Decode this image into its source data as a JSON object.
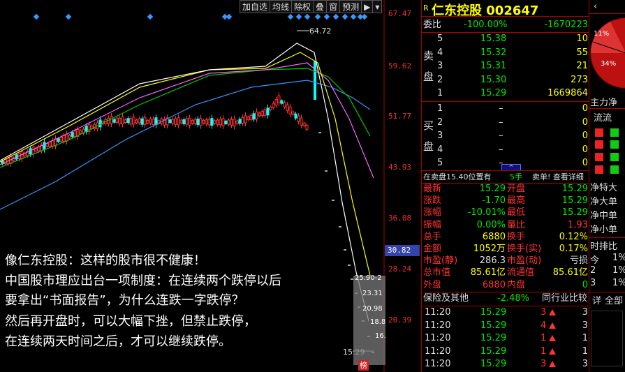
{
  "toolbar": {
    "buttons": [
      "加自选",
      "均线",
      "除权",
      "叠",
      "窗",
      "预测",
      "▶",
      "▾"
    ]
  },
  "chart": {
    "price_axis": [
      "67.47",
      "59.62",
      "51.77",
      "43.93",
      "36.08",
      "28.24",
      "20.39"
    ],
    "current_price_label": "30.82",
    "high_label": "64.72",
    "low_label": "15.29",
    "gray_box_texts": [
      "25.90-2",
      "23.31",
      "20.98",
      "18.8",
      "16."
    ],
    "badge": "榜",
    "overlay_lines": [
      "像仁东控股：这样的股市很不健康！",
      "中国股市理应出台一项制度：在连续两个跌停以后",
      "要拿出“书面报告”，为什么连跌一字跌停？",
      "然后再开盘时，可以大幅下挫，但禁止跌停，",
      "在连续两天时间之后，才可以继续跌停。"
    ],
    "colors": {
      "up": "#ff3333",
      "down": "#00ffff",
      "ma5": "#ffffff",
      "ma10": "#ffff00",
      "ma20": "#ff66ff",
      "ma30": "#00cc00",
      "ma60": "#3399ff"
    }
  },
  "quote": {
    "r_mark": "R",
    "title": "仁东控股 002647",
    "weibi": {
      "label": "委比",
      "pct": "-100.00%",
      "diff": "-1670223"
    },
    "sell_label": "卖盘",
    "buy_label": "买盘",
    "sell": [
      {
        "n": "5",
        "price": "15.38",
        "vol": "10"
      },
      {
        "n": "4",
        "price": "15.32",
        "vol": "55"
      },
      {
        "n": "3",
        "price": "15.31",
        "vol": "21"
      },
      {
        "n": "2",
        "price": "15.30",
        "vol": "273"
      },
      {
        "n": "1",
        "price": "15.29",
        "vol": "1669864"
      }
    ],
    "buy": [
      {
        "n": "1",
        "price": "–",
        "vol": "0"
      },
      {
        "n": "2",
        "price": "–",
        "vol": "0"
      },
      {
        "n": "3",
        "price": "–",
        "vol": "0"
      },
      {
        "n": "4",
        "price": "–",
        "vol": "0"
      },
      {
        "n": "5",
        "price": "–",
        "vol": "0"
      }
    ],
    "big_order": {
      "text": "在卖盘15.40位置有",
      "qty": "5手",
      "suffix": "卖单! 查看详细"
    },
    "stats": [
      {
        "l1": "最新",
        "v1": "15.29",
        "l2": "开盘",
        "v2": "15.29",
        "c1": "green",
        "c2": "green"
      },
      {
        "l1": "涨跌",
        "v1": "-1.70",
        "l2": "最高",
        "v2": "15.29",
        "c1": "green",
        "c2": "green"
      },
      {
        "l1": "涨幅",
        "v1": "-10.01%",
        "l2": "最低",
        "v2": "15.29",
        "c1": "green",
        "c2": "green"
      },
      {
        "l1": "振幅",
        "v1": "0.00%",
        "l2": "量比",
        "v2": "1.93",
        "c1": "green",
        "c2": "red"
      },
      {
        "l1": "总手",
        "v1": "6880",
        "l2": "换手",
        "v2": "0.12%",
        "c1": "yellow",
        "c2": "yellow"
      },
      {
        "l1": "金额",
        "v1": "1052万",
        "l2": "换手(实)",
        "v2": "0.17%",
        "c1": "yellow",
        "c2": "yellow"
      },
      {
        "l1": "市盈(静)",
        "v1": "286.3",
        "l2": "市盈(动)",
        "v2": "亏损",
        "c1": "white",
        "c2": "white"
      },
      {
        "l1": "总市值",
        "v1": "85.61亿",
        "l2": "流通值",
        "v2": "85.61亿",
        "c1": "yellow",
        "c2": "yellow"
      },
      {
        "l1": "外盘",
        "v1": "6880",
        "l2": "内盘",
        "v2": "0",
        "c1": "red",
        "c2": "green"
      }
    ],
    "sector": {
      "name": "保险及其他",
      "pct": "-2.48%",
      "compare": "同行业比较"
    },
    "ticks": [
      {
        "time": "11:20",
        "price": "15.29",
        "vol": "3",
        "extra": "3"
      },
      {
        "time": "11:20",
        "price": "15.29",
        "vol": "4",
        "extra": "3"
      },
      {
        "time": "11:20",
        "price": "15.29",
        "vol": "1",
        "extra": "1"
      },
      {
        "time": "11:20",
        "price": "15.29",
        "vol": "1",
        "extra": "1"
      },
      {
        "time": "11:20",
        "price": "15.29",
        "vol": "3",
        "extra": "3"
      }
    ]
  },
  "side": {
    "pct_top": "11%",
    "pct_bottom": "34%",
    "zhuli": "主力净",
    "liu": "流流",
    "labels_mid": [
      "净特大",
      "净大单",
      "净中单",
      "净小单"
    ],
    "rank_title": "时排比",
    "ranks": [
      {
        "n": "今",
        "v": "1%"
      },
      {
        "n": "2",
        "v": "1%"
      },
      {
        "n": "3",
        "v": "1%"
      }
    ],
    "bottom": [
      "详",
      "全部"
    ]
  }
}
